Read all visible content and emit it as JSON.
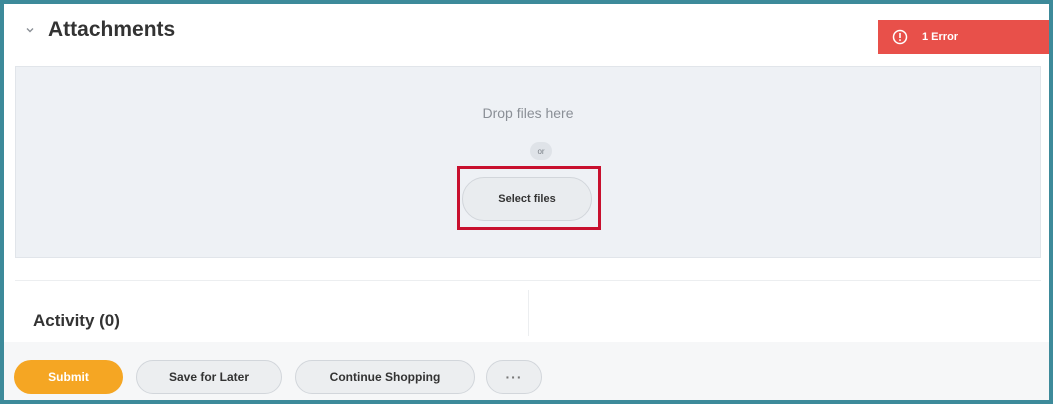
{
  "section": {
    "title": "Attachments",
    "collapse_icon": "chevron-down-icon"
  },
  "error_badge": {
    "icon": "alert-circle-icon",
    "label": "1 Error",
    "color": "#e8504a"
  },
  "dropzone": {
    "drop_text": "Drop files here",
    "or_text": "or",
    "select_label": "Select files",
    "highlight_color": "#c8102e"
  },
  "activity": {
    "title": "Activity (0)"
  },
  "footer": {
    "submit_label": "Submit",
    "save_label": "Save for Later",
    "continue_label": "Continue Shopping",
    "more_label": "···",
    "submit_color": "#f5a623"
  },
  "frame_color": "#3d8a9a"
}
